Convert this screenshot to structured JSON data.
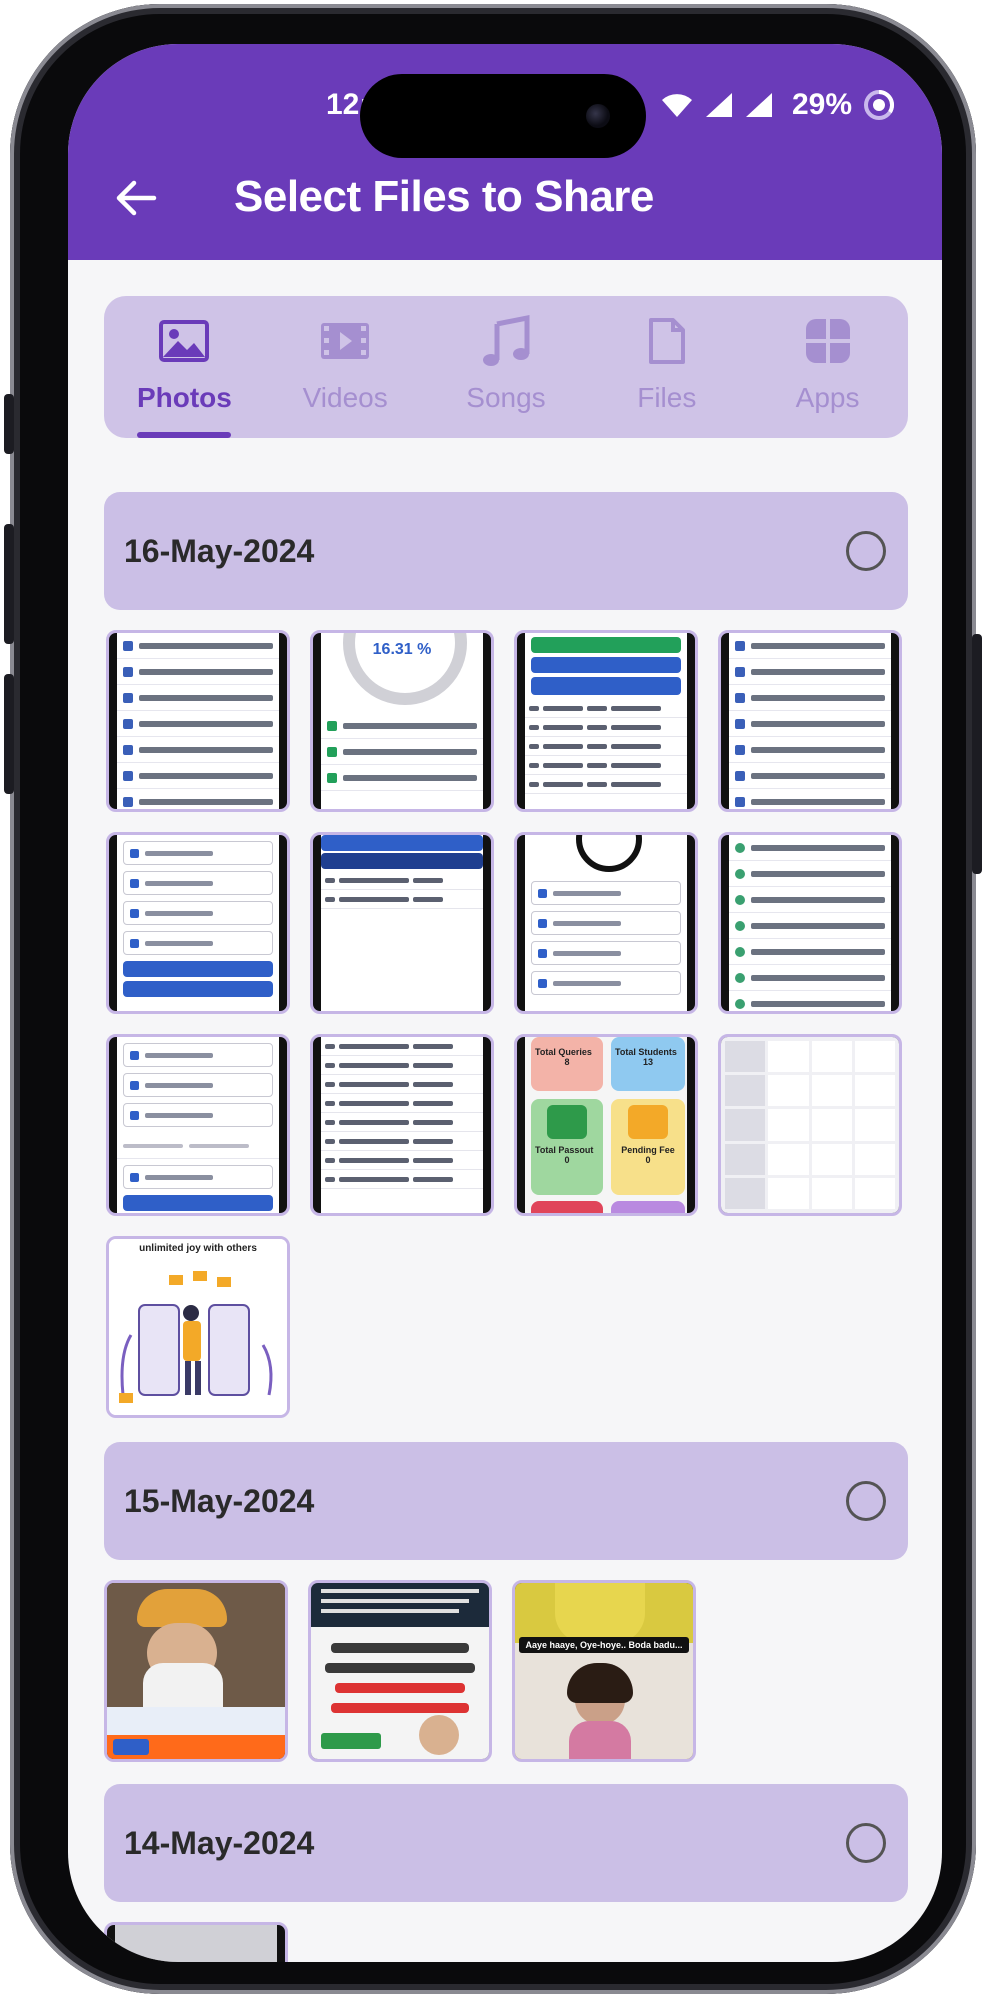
{
  "status_bar": {
    "time": "12:",
    "battery": "29%"
  },
  "app_bar": {
    "title": "Select Files to Share",
    "back_icon": "arrow-left-icon"
  },
  "tabs": [
    {
      "label": "Photos",
      "icon": "image-icon",
      "active": true
    },
    {
      "label": "Videos",
      "icon": "film-icon",
      "active": false
    },
    {
      "label": "Songs",
      "icon": "music-note-icon",
      "active": false
    },
    {
      "label": "Files",
      "icon": "file-icon",
      "active": false
    },
    {
      "label": "Apps",
      "icon": "apps-grid-icon",
      "active": false
    }
  ],
  "groups": [
    {
      "date": "16-May-2024",
      "selected": false,
      "count": 13
    },
    {
      "date": "15-May-2024",
      "selected": false,
      "count": 3
    },
    {
      "date": "14-May-2024",
      "selected": false
    }
  ],
  "thumb_text": {
    "progress_percent": "16.31 %",
    "queries_label": "Total Queries",
    "queries_value": "8",
    "students_label": "Total Students",
    "students_value": "13",
    "passout_label": "Total Passout",
    "passout_value": "0",
    "pending_fee_label": "Pending Fee",
    "pending_fee_value": "0",
    "joy_caption": "unlimited joy with others",
    "meme_caption": "Aaye haaye, Oye-hoye.. Boda badu..."
  },
  "colors": {
    "primary": "#6a3bb9",
    "tab_bg": "#cfc3e7",
    "header_bg": "#cbbfe6",
    "thumb_border": "#c6b6e6"
  }
}
